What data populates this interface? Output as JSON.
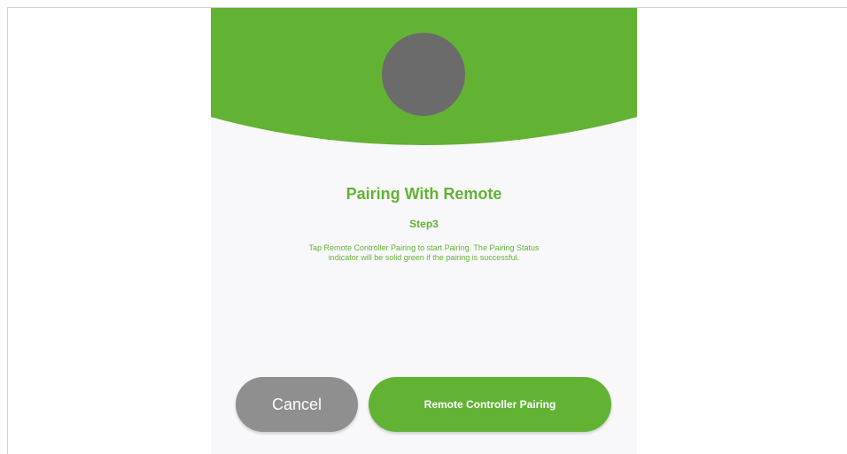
{
  "colors": {
    "accent": "#62b333",
    "avatar": "#6b6b6b",
    "cancel_button": "#8f8f8f",
    "background": "#f8f8fa"
  },
  "header": {
    "icon": "avatar-placeholder"
  },
  "content": {
    "title": "Pairing With Remote",
    "step": "Step3",
    "description": "Tap Remote Controller Pairing to start Pairing. The Pairing Status indicator will be solid green if the pairing is successful."
  },
  "buttons": {
    "cancel_label": "Cancel",
    "pair_label": "Remote Controller Pairing"
  }
}
